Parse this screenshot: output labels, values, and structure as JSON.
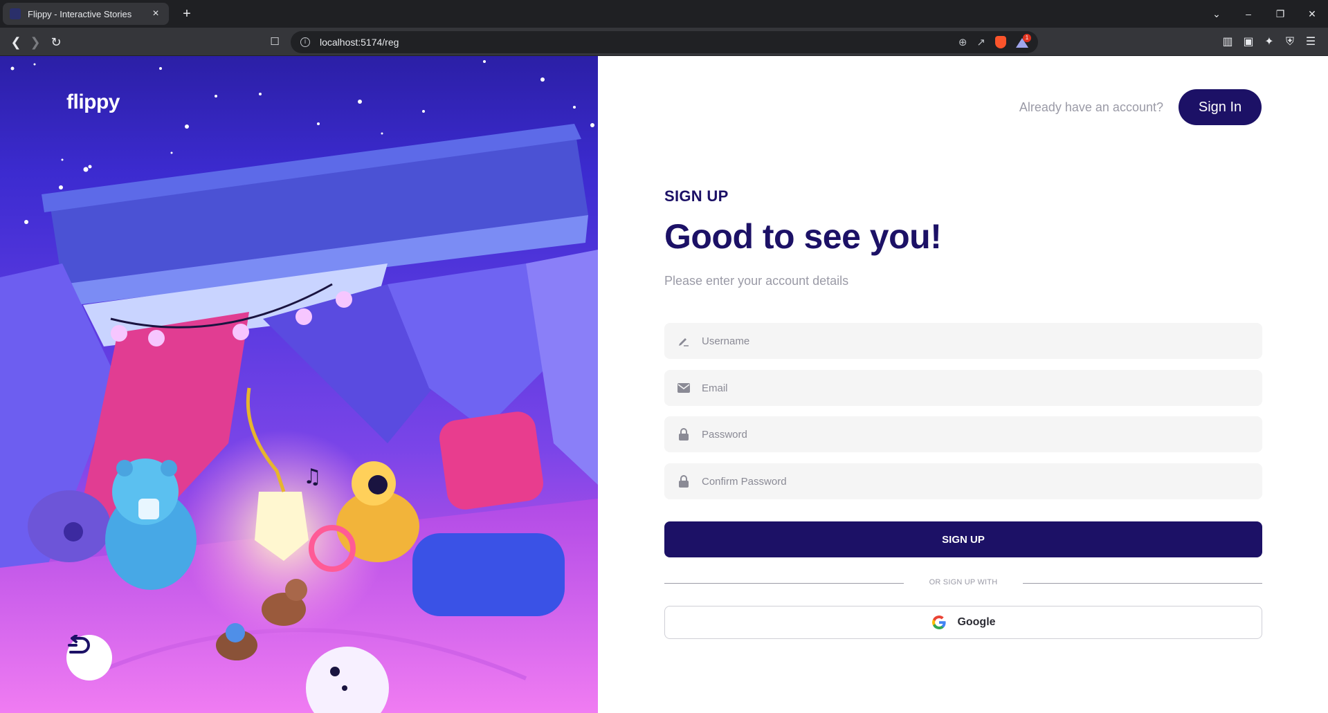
{
  "browser": {
    "tab_title": "Flippy - Interactive Stories",
    "tab_close": "×",
    "new_tab": "+",
    "url": "localhost:5174/reg",
    "reward_badge": "1",
    "win": {
      "dropdown": "⌄",
      "minimize": "–",
      "restore": "❐",
      "close": "✕"
    }
  },
  "brand": {
    "logo": "flippy"
  },
  "header": {
    "prompt": "Already have an account?",
    "signin_label": "Sign In"
  },
  "form": {
    "eyebrow": "SIGN UP",
    "headline": "Good to see you!",
    "subtitle": "Please enter your account details",
    "fields": [
      {
        "placeholder": "Username",
        "icon": "pencil-icon"
      },
      {
        "placeholder": "Email",
        "icon": "mail-icon"
      },
      {
        "placeholder": "Password",
        "icon": "lock-icon"
      },
      {
        "placeholder": "Confirm Password",
        "icon": "lock-icon"
      }
    ],
    "submit_label": "SIGN UP",
    "divider_text": "OR SIGN UP WITH",
    "google_label": "Google"
  },
  "colors": {
    "brand_navy": "#1c1166",
    "muted_text": "#9a9aa6",
    "field_bg": "#f5f5f5"
  }
}
